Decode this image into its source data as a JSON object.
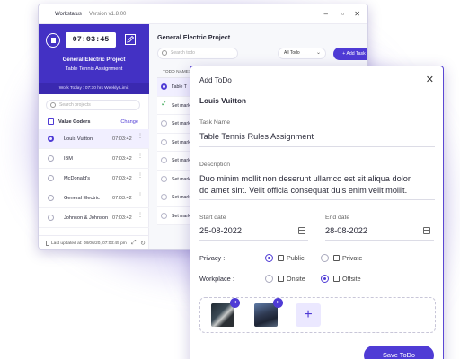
{
  "app": {
    "name": "Workstatus",
    "version": "Version v1.8.00",
    "controls": {
      "minimize": "–",
      "maximize": "▫",
      "close": "✕"
    }
  },
  "sidebar": {
    "timer": "07:03:45",
    "project": "General Electric Project",
    "task": "Table Tennis Assignment",
    "work_today": "Work Today : 07:30 hrs Weekly Limit",
    "search_placeholder": "Search projects",
    "client_header": "Value Coders",
    "change_label": "Change",
    "clients": [
      {
        "name": "Louis Vuitton",
        "time": "07:03:42",
        "active": true
      },
      {
        "name": "IBM",
        "time": "07:03:42",
        "active": false
      },
      {
        "name": "McDonald's",
        "time": "07:03:42",
        "active": false
      },
      {
        "name": "General Electric",
        "time": "07:03:42",
        "active": false
      },
      {
        "name": "Johnson & Johnson",
        "time": "07:03:42",
        "active": false
      }
    ],
    "last_updated": "Last updated at: 08/06/20, 07:03:45 pm"
  },
  "main": {
    "title": "General Electric Project",
    "search_placeholder": "Search todo",
    "filter_value": "All Todo",
    "add_task_label": "+ Add Task",
    "column_header": "TODO NAMES",
    "rows": [
      {
        "text": "Table T",
        "status": "running",
        "active": true
      },
      {
        "text": "Set mark",
        "status": "done",
        "active": false
      },
      {
        "text": "Set mark",
        "status": "todo",
        "active": false
      },
      {
        "text": "Set mark",
        "status": "todo",
        "active": false
      },
      {
        "text": "Set mark",
        "status": "todo",
        "active": false
      },
      {
        "text": "Set mark",
        "status": "todo",
        "active": false
      },
      {
        "text": "Set mark",
        "status": "todo",
        "active": false
      },
      {
        "text": "Set mark",
        "status": "todo",
        "active": false
      }
    ]
  },
  "dialog": {
    "title": "Add ToDo",
    "close": "✕",
    "client": "Louis Vuitton",
    "task_name_label": "Task Name",
    "task_name": "Table Tennis Rules Assignment",
    "description_label": "Description",
    "description_line1": "Duo minim mollit non deserunt ullamco est sit aliqua dolor",
    "description_line2": "do amet sint. Velit officia consequat duis enim velit mollit.",
    "start_label": "Start date",
    "start_value": "25-08-2022",
    "end_label": "End date",
    "end_value": "28-08-2022",
    "privacy_label": "Privacy :",
    "privacy_public": "Public",
    "privacy_private": "Private",
    "privacy_selected": "Public",
    "workplace_label": "Workplace :",
    "workplace_onsite": "Onsite",
    "workplace_offsite": "Offsite",
    "workplace_selected": "Offsite",
    "attachment_count": 2,
    "add_image": "+",
    "remove": "×",
    "save_label": "Save ToDo"
  },
  "colors": {
    "accent": "#4f3bd5",
    "sidebar_dark": "#4331c4",
    "done_green": "#2fa24b"
  }
}
